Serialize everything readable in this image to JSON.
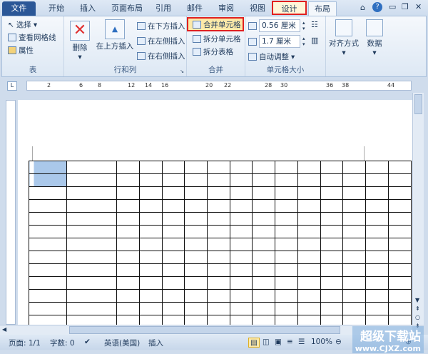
{
  "tabs": [
    "文件",
    "开始",
    "插入",
    "页面布局",
    "引用",
    "邮件",
    "审阅",
    "视图",
    "设计",
    "布局"
  ],
  "window_icons": [
    "minimize-ribbon-icon",
    "help-icon",
    "minimize-icon",
    "restore-icon",
    "close-icon"
  ],
  "ribbon": {
    "table_group": {
      "label": "表",
      "items": [
        "选择",
        "查看网格线",
        "属性"
      ]
    },
    "rows_cols_group": {
      "label": "行和列",
      "delete": "删除",
      "insert_above": "在上方插入",
      "insert_below": "在下方插入",
      "insert_left": "在左侧插入",
      "insert_right": "在右侧插入"
    },
    "merge_group": {
      "label": "合并",
      "merge_cells": "合并单元格",
      "split_cells": "拆分单元格",
      "split_table": "拆分表格"
    },
    "cell_size_group": {
      "label": "单元格大小",
      "height": "0.56 厘米",
      "width": "1.7 厘米",
      "autofit": "自动调整"
    },
    "align": "对齐方式",
    "data": "数据"
  },
  "ruler": [
    "2",
    "6",
    "8",
    "12",
    "14",
    "16",
    "20",
    "22",
    "28",
    "30",
    "36",
    "38",
    "44"
  ],
  "status": {
    "page": "页面: 1/1",
    "words": "字数: 0",
    "language": "英语(美国)",
    "mode": "插入",
    "zoom": "100%"
  },
  "watermark": {
    "title": "超级下载站",
    "url": "www.CJXZ.com"
  },
  "table": {
    "rows": 14,
    "cols": 15,
    "selected": "第一列前两行"
  }
}
